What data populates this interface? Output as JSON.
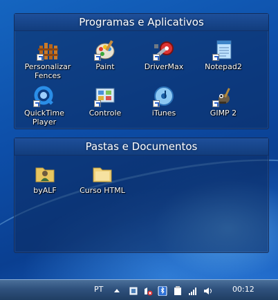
{
  "fences": [
    {
      "title": "Programas e Aplicativos",
      "items": [
        {
          "label": "Personalizar Fences",
          "icon": "fences-icon"
        },
        {
          "label": "Paint",
          "icon": "paint-icon"
        },
        {
          "label": "DriverMax",
          "icon": "drivermax-icon"
        },
        {
          "label": "Notepad2",
          "icon": "notepad-icon"
        },
        {
          "label": "QuickTime Player",
          "icon": "quicktime-icon"
        },
        {
          "label": "Controle",
          "icon": "control-panel-icon"
        },
        {
          "label": "iTunes",
          "icon": "itunes-icon"
        },
        {
          "label": "GIMP 2",
          "icon": "gimp-icon"
        }
      ]
    },
    {
      "title": "Pastas e Documentos",
      "items": [
        {
          "label": "byALF",
          "icon": "user-folder-icon"
        },
        {
          "label": "Curso HTML",
          "icon": "folder-icon"
        }
      ]
    }
  ],
  "taskbar": {
    "language": "PT",
    "clock": "00:12"
  },
  "colors": {
    "desktop": "#1565c0",
    "fence_bg": "#0c2a5c",
    "taskbar": "#2f517d"
  }
}
